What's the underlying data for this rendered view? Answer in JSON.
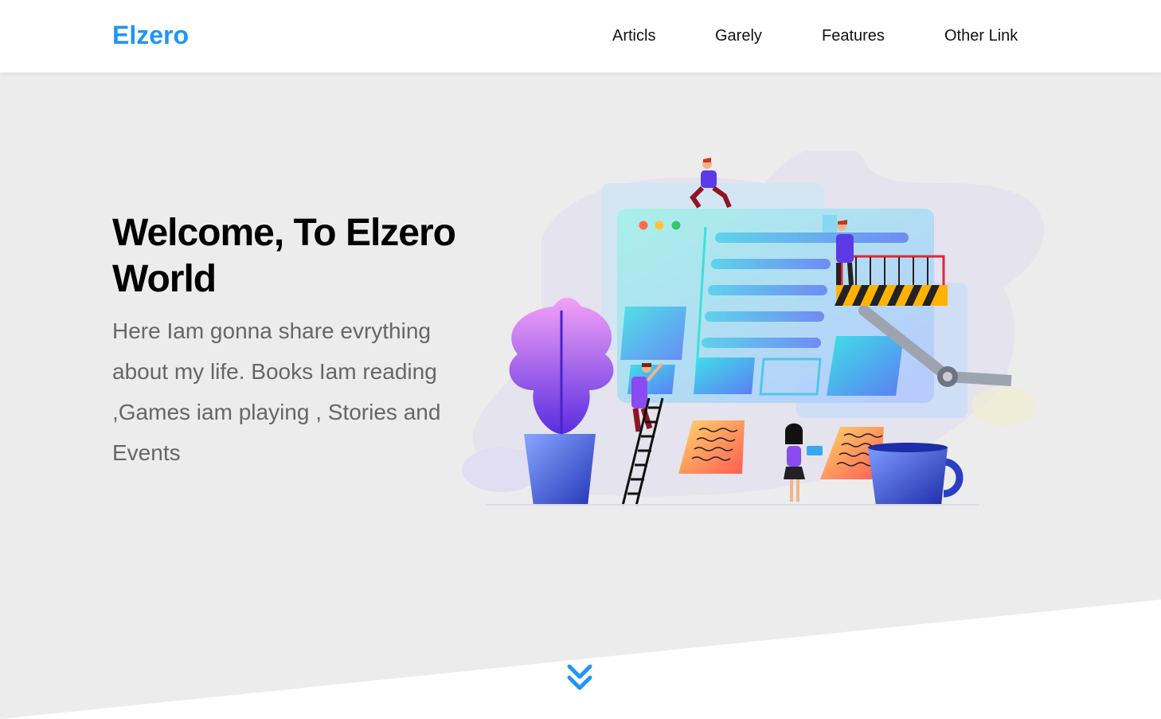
{
  "header": {
    "logo": "Elzero",
    "nav": [
      "Articls",
      "Garely",
      "Features",
      "Other Link"
    ]
  },
  "hero": {
    "title": "Welcome, To Elzero World",
    "text": "Here Iam gonna share evrything about my life. Books Iam reading ,Games iam playing , Stories and Events"
  },
  "icons": {
    "scroll_down": "angles-down-icon"
  },
  "colors": {
    "accent": "#2196f3",
    "landing_bg": "#ececec",
    "heading": "#000000",
    "body_text": "#666666"
  }
}
